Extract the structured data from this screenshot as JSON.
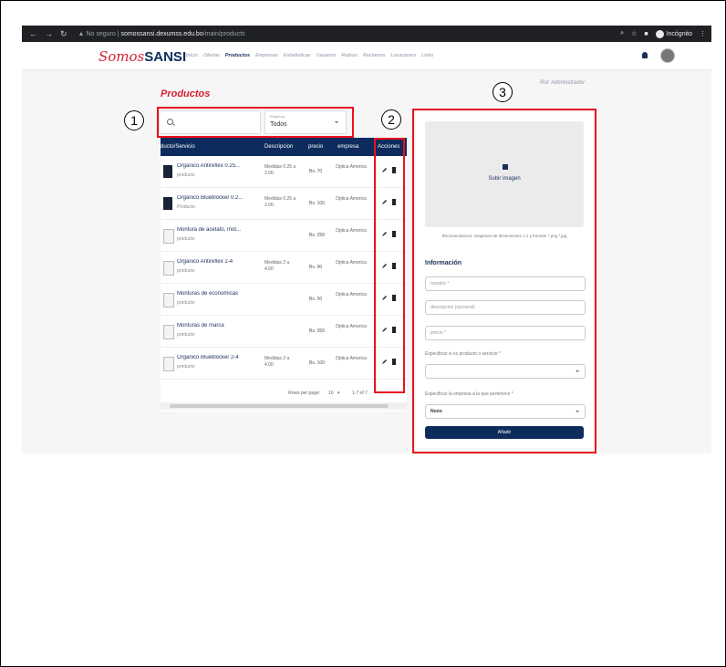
{
  "browser": {
    "security": "No seguro",
    "url_host": "somossansi.dexumss.edu.bo",
    "url_path": "/main/products",
    "profile": "Incógnito"
  },
  "app": {
    "logo_somos": "Somos",
    "logo_sansi": "SANSI",
    "menu": [
      "Inicio",
      "Ofertas",
      "Productos",
      "Empresas",
      "Estadísticas",
      "Usuarios",
      "Rubros",
      "Reclamos",
      "Locaciones",
      "Links"
    ],
    "active_menu": "Productos"
  },
  "page": {
    "title": "Productos",
    "rol": "Rol: Administrador"
  },
  "filters": {
    "search_placeholder": "",
    "select_label": "Empresa",
    "select_value": "Todos"
  },
  "table": {
    "headers": [
      "ducto/Servicio",
      "Descripcion",
      "precio",
      "empresa",
      "Acciones"
    ],
    "rows": [
      {
        "name": "Organico Antireflex 0.25...",
        "type": "producto",
        "desc": "Medidas 0.25 a 2.00",
        "price": "Bs. 70",
        "empresa": "Optica America",
        "thumb": "dark"
      },
      {
        "name": "Organico Blueblocker 0.2...",
        "type": "Producto",
        "desc": "Medidas 0.25 a 2.00",
        "price": "Bs. 100",
        "empresa": "Optica America",
        "thumb": "dark"
      },
      {
        "name": "Montura de acetato, mot...",
        "type": "producto",
        "desc": "",
        "price": "Bs. 250",
        "empresa": "Optica America",
        "thumb": "file"
      },
      {
        "name": "Organico Antireflex 2-4",
        "type": "producto",
        "desc": "Medidas 2 a 4.00",
        "price": "Bs. 90",
        "empresa": "Optica America",
        "thumb": "file"
      },
      {
        "name": "Monturas de economicas",
        "type": "producto",
        "desc": "",
        "price": "Bs. 50",
        "empresa": "Optica America",
        "thumb": "file"
      },
      {
        "name": "Monturas de marca",
        "type": "producto",
        "desc": "",
        "price": "Bs. 350",
        "empresa": "Optica America",
        "thumb": "file"
      },
      {
        "name": "Organico Blueblocker 2-4",
        "type": "producto",
        "desc": "Medidas 2 a 4.00",
        "price": "Bs. 100",
        "empresa": "Optica America",
        "thumb": "file"
      }
    ],
    "rows_per_page_label": "Rows per page:",
    "rows_per_page": "10",
    "range": "1-7 of 7"
  },
  "form": {
    "upload_label": "Subir imagen",
    "recommendation": "Recomendacion: imagenes de dimensiones 1:1 y formato *.png *.jpg",
    "info_title": "Información",
    "nombre_placeholder": "nombre *",
    "descripcion_placeholder": "descripcion (opcional)",
    "precio_placeholder": "precio *",
    "tipo_label": "Especificar si es producto o servicio *",
    "tipo_value": "",
    "empresa_label": "Especificar la empresa a la que pertenece *",
    "empresa_value": "Nono",
    "submit_label": "Añadir"
  },
  "annotations": [
    "1",
    "2",
    "3"
  ],
  "colors": {
    "brand_navy": "#0d2b5c",
    "brand_red": "#d72030",
    "annotation_red": "#e8121e"
  }
}
